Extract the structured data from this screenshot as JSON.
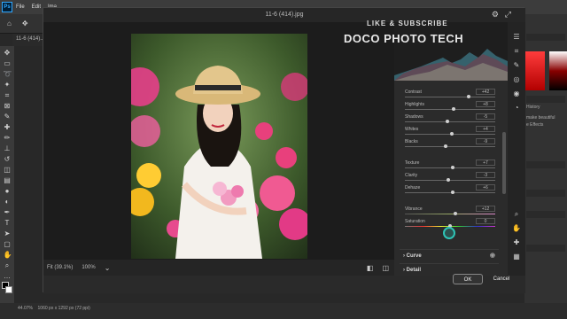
{
  "ps": {
    "menu": [
      "File",
      "Edit",
      "Ima"
    ],
    "doc_tab": "11-6 (414)...",
    "status_zoom": "44.07%",
    "status_size": "1060 px x 1292 px (72 ppi)",
    "panel_history": "History",
    "panel_line1": "make beautiful",
    "panel_line2": "e Effects"
  },
  "dialog": {
    "title": "11-6 (414).jpg",
    "zoom_fit": "Fit (39.1%)",
    "zoom_100": "100%",
    "ok_label": "OK",
    "cancel_label": "Cancel"
  },
  "watermark": {
    "line1": "LIKE & SUBSCRIBE",
    "line2": "DOCO PHOTO TECH"
  },
  "sliders": [
    {
      "label": "Contrast",
      "value": "+42",
      "frac": 0.71
    },
    {
      "label": "Highlights",
      "value": "+8",
      "frac": 0.54
    },
    {
      "label": "Shadows",
      "value": "-5",
      "frac": 0.47
    },
    {
      "label": "Whites",
      "value": "+4",
      "frac": 0.52
    },
    {
      "label": "Blacks",
      "value": "-9",
      "frac": 0.45
    }
  ],
  "sliders2": [
    {
      "label": "Texture",
      "value": "+7",
      "frac": 0.53
    },
    {
      "label": "Clarity",
      "value": "-3",
      "frac": 0.48
    },
    {
      "label": "Dehaze",
      "value": "+6",
      "frac": 0.53
    }
  ],
  "sliders3": [
    {
      "label": "Vibrance",
      "value": "+12",
      "frac": 0.56
    },
    {
      "label": "Saturation",
      "value": "0",
      "frac": 0.5
    }
  ],
  "sections": {
    "curve": "Curve",
    "detail": "Detail"
  },
  "colors": {
    "accent": "#2ec4b6",
    "bg": "#1f1f1f"
  }
}
